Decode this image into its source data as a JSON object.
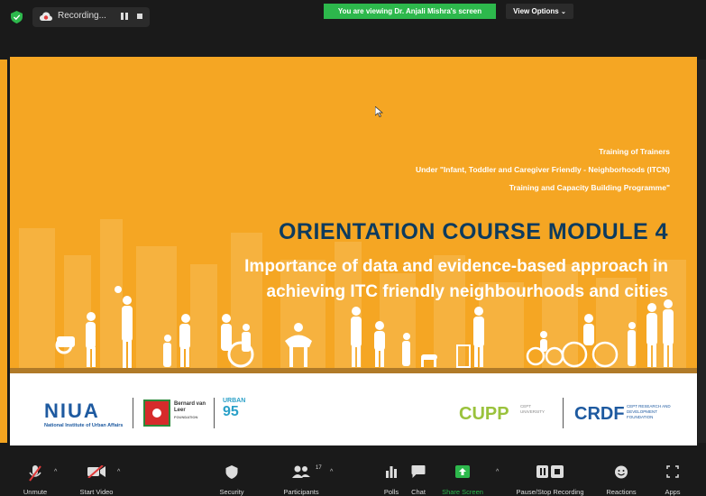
{
  "topbar": {
    "recording_label": "Recording...",
    "viewing_banner": "You are viewing Dr. Anjali Mishra's screen",
    "view_options_label": "View Options",
    "view_options_caret": "⌄"
  },
  "slide": {
    "line1": "Training of Trainers",
    "line2": "Under \"Infant, Toddler and Caregiver Friendly - Neighborhoods (ITCN)",
    "line3": "Training and Capacity Building Programme\"",
    "title": "ORIENTATION COURSE MODULE 4",
    "subtitle1": "Importance of data and evidence-based approach in",
    "subtitle2": "achieving ITC friendly neighbourhoods and cities",
    "logos": {
      "niua_mark": "NIUA",
      "niua_caption": "National Institute of Urban Affairs",
      "bvl_name": "Bernard van Leer",
      "bvl_foundation": "FOUNDATION",
      "urban_top": "URBAN",
      "urban_bottom": "95",
      "cupp": "CUPP",
      "cupp_caption": "CEPT UNIVERSITY",
      "crdf": "CRDF",
      "crdf_caption": "CEPT RESEARCH AND DEVELOPMENT FOUNDATION"
    }
  },
  "toolbar": {
    "unmute": "Unmute",
    "start_video": "Start Video",
    "security": "Security",
    "participants": "Participants",
    "participants_count": "17",
    "polls": "Polls",
    "chat": "Chat",
    "share_screen": "Share Screen",
    "pause_stop": "Pause/Stop Recording",
    "reactions": "Reactions",
    "apps": "Apps"
  },
  "colors": {
    "slide_bg": "#f5a623",
    "title_color": "#0d3b5e",
    "banner_green": "#2db84c",
    "toolbar_bg": "#1a1a1a"
  }
}
